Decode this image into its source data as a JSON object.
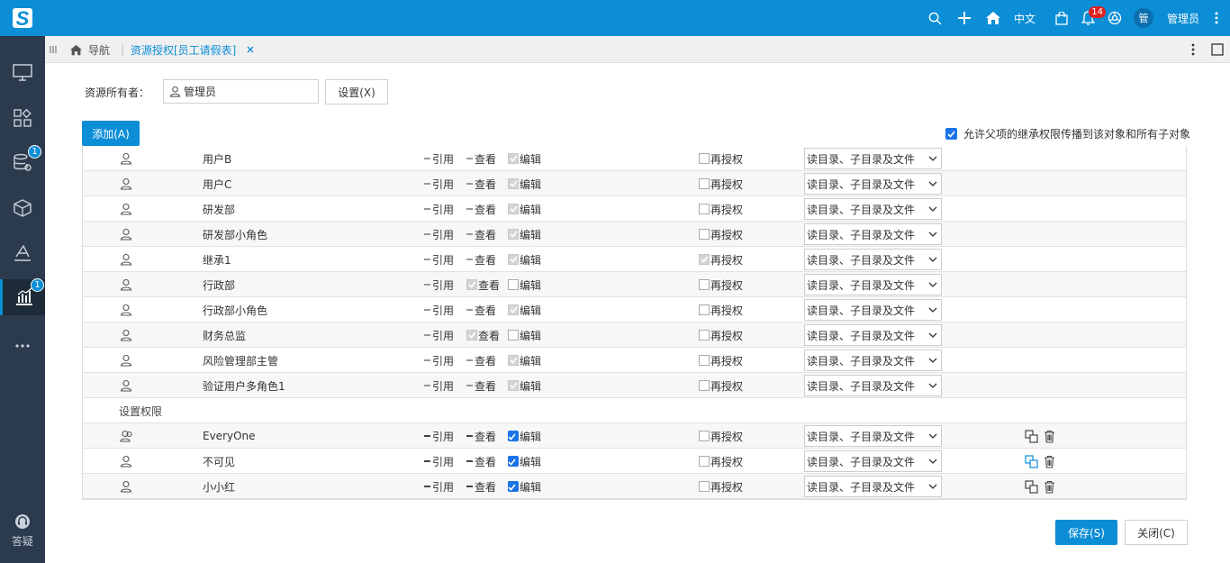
{
  "app": {
    "language": "中文",
    "notification_count": "14",
    "avatar_text": "管",
    "user_name": "管理员"
  },
  "sidebar": {
    "badge_data": "1",
    "badge_analysis": "1",
    "help_label": "答疑"
  },
  "tabs": {
    "nav_label": "导航",
    "active_label": "资源授权[员工请假表]"
  },
  "form": {
    "owner_label": "资源所有者：",
    "owner_value": "管理员",
    "set_button": "设置(X)",
    "add_button": "添加(A)",
    "inherit_label": "允许父项的继承权限传播到该对象和所有子对象",
    "save_button": "保存(S)",
    "close_button": "关闭(C)"
  },
  "perm_labels": {
    "ref": "引用",
    "view": "查看",
    "edit": "编辑",
    "regrant": "再授权",
    "scope": "读目录、子目录及文件"
  },
  "section_label": "设置权限",
  "inherited_rows": [
    {
      "name": "用户B",
      "view": "none",
      "edit": "disabled-checked",
      "regrant": "empty"
    },
    {
      "name": "用户C",
      "view": "none",
      "edit": "disabled-checked",
      "regrant": "empty"
    },
    {
      "name": "研发部",
      "view": "none",
      "edit": "disabled-checked",
      "regrant": "empty"
    },
    {
      "name": "研发部小角色",
      "view": "none",
      "edit": "disabled-checked",
      "regrant": "empty"
    },
    {
      "name": "继承1",
      "view": "none",
      "edit": "disabled-checked",
      "regrant": "disabled-checked"
    },
    {
      "name": "行政部",
      "view": "disabled-checked",
      "edit": "empty",
      "regrant": "empty"
    },
    {
      "name": "行政部小角色",
      "view": "none",
      "edit": "disabled-checked",
      "regrant": "empty"
    },
    {
      "name": "财务总监",
      "view": "disabled-checked",
      "edit": "empty",
      "regrant": "empty"
    },
    {
      "name": "风险管理部主管",
      "view": "none",
      "edit": "disabled-checked",
      "regrant": "empty"
    },
    {
      "name": "验证用户多角色1",
      "view": "none",
      "edit": "disabled-checked",
      "regrant": "empty"
    }
  ],
  "own_rows": [
    {
      "name": "EveryOne",
      "icon": "group-icon"
    },
    {
      "name": "不可见",
      "icon": "user-icon"
    },
    {
      "name": "小小红",
      "icon": "user-icon"
    }
  ],
  "colors": {
    "brand": "#0b8ed6",
    "sidebar": "#2b3a4c",
    "check": "#1a73e8",
    "badge_red": "#e02020"
  }
}
